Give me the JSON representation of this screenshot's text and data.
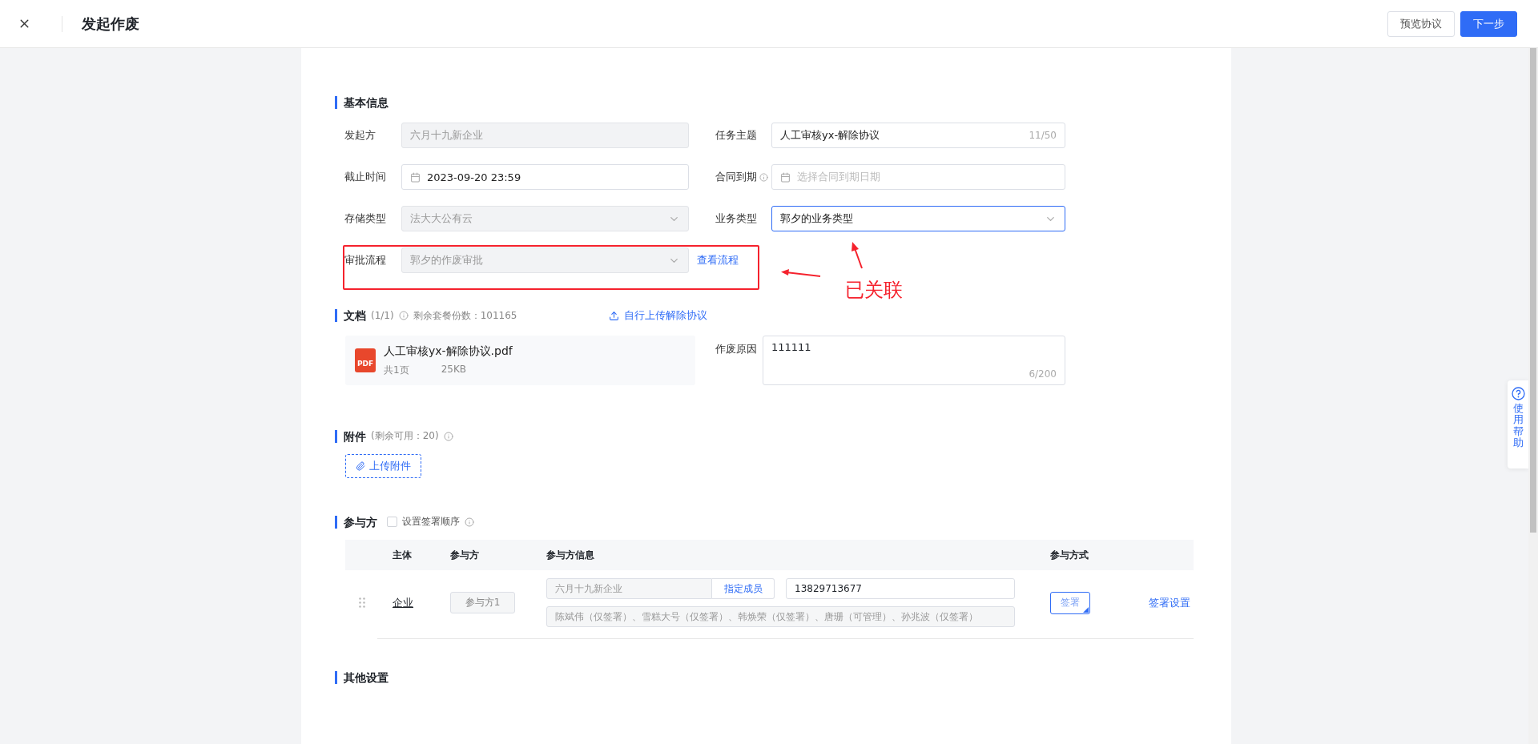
{
  "header": {
    "title": "发起作废",
    "buttons": [
      {
        "label": "预览协议",
        "kind": "secondary"
      },
      {
        "label": "下一步",
        "kind": "primary"
      }
    ]
  },
  "basic_info": {
    "title": "基本信息",
    "fields": [
      {
        "label": "发起方",
        "kind": "input",
        "value": "六月十九新企业",
        "disabled": true
      },
      {
        "label": "任务主题",
        "kind": "input",
        "value": "人工审核yx-解除协议",
        "counter": "11/50",
        "disabled": false
      },
      {
        "label": "截止时间",
        "kind": "date",
        "value": "2023-09-20 23:59",
        "disabled": false
      },
      {
        "label": "合同到期",
        "kind": "date",
        "placeholder": "选择合同到期日期",
        "info": true,
        "disabled": false
      },
      {
        "label": "存储类型",
        "kind": "select",
        "value": "法大大公有云",
        "disabled": true
      },
      {
        "label": "业务类型",
        "kind": "select",
        "value": "郭夕的业务类型",
        "focused": true,
        "disabled": false
      },
      {
        "label": "审批流程",
        "kind": "select",
        "value": "郭夕的作废审批",
        "disabled": true,
        "link": "查看流程"
      }
    ]
  },
  "document": {
    "title": "文档",
    "count": "(1/1)",
    "quota": "剩余套餐份数：101165",
    "upload_link": "自行上传解除协议",
    "file": {
      "name": "人工审核yx-解除协议.pdf",
      "badge": "PDF",
      "pages": "共1页",
      "size": "25KB"
    },
    "reason": {
      "label": "作废原因",
      "value": "111111",
      "counter": "6/200"
    }
  },
  "attachments": {
    "title": "附件",
    "note": "(剩余可用：20)",
    "button": "上传附件"
  },
  "participants": {
    "title": "参与方",
    "order_checkbox": {
      "label": "设置签署顺序",
      "checked": false
    },
    "columns": [
      "主体",
      "参与方",
      "参与方信息",
      "参与方式"
    ],
    "rows": [
      {
        "entity": "企业",
        "party": "参与方1",
        "company": "六月十九新企业",
        "assign": "指定成员",
        "phone": "13829713677",
        "members": "陈斌伟（仅签署）、雪糕大号（仅签署）、韩焕荣（仅签署）、唐珊（可管理）、孙兆波（仅签署）",
        "mode": "签署",
        "settings": "签署设置"
      }
    ]
  },
  "other_settings": {
    "title": "其他设置"
  },
  "help": {
    "label": "使用帮助"
  },
  "annotation": {
    "label": "已关联"
  }
}
